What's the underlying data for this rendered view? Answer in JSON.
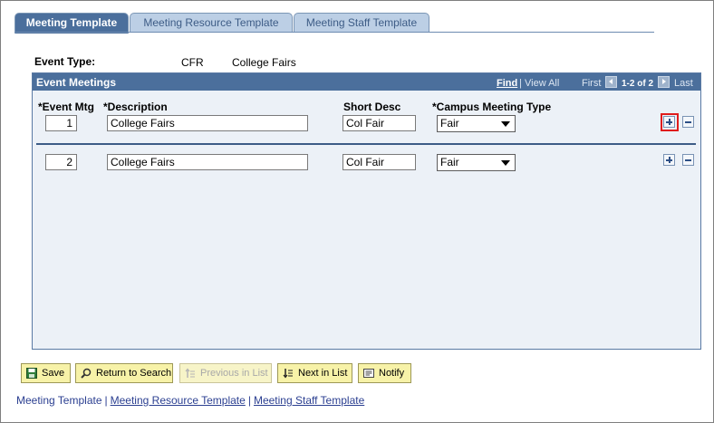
{
  "tabs": [
    {
      "label": "Meeting Template",
      "active": true
    },
    {
      "label": "Meeting Resource Template",
      "active": false
    },
    {
      "label": "Meeting Staff Template",
      "active": false
    }
  ],
  "event_type": {
    "label": "Event Type:",
    "code": "CFR",
    "description": "College Fairs"
  },
  "grid": {
    "title": "Event Meetings",
    "find": "Find",
    "view_all": "View All",
    "first": "First",
    "range": "1-2 of 2",
    "last": "Last",
    "columns": {
      "event_mtg": "*Event Mtg",
      "description": "*Description",
      "short_desc": "Short Desc",
      "campus_meeting_type": "*Campus Meeting Type"
    },
    "rows": [
      {
        "event_mtg": "1",
        "description": "College Fairs",
        "short_desc": "Col Fair",
        "meeting_type": "Fair"
      },
      {
        "event_mtg": "2",
        "description": "College Fairs",
        "short_desc": "Col Fair",
        "meeting_type": "Fair"
      }
    ]
  },
  "toolbar": {
    "save": "Save",
    "return_to_search": "Return to Search",
    "previous_in_list": "Previous in List",
    "next_in_list": "Next in List",
    "notify": "Notify"
  },
  "footer_links": {
    "meeting_template": "Meeting Template",
    "meeting_resource_template": "Meeting Resource Template",
    "meeting_staff_template": "Meeting Staff Template",
    "separator": "|"
  },
  "colors": {
    "tab_active": "#4b6f9c",
    "tab_inactive": "#bccfe5",
    "grid_header": "#4b6f9c",
    "grid_body": "#ecf1f7",
    "button": "#f7f2a8",
    "highlight": "#e01c1c"
  }
}
